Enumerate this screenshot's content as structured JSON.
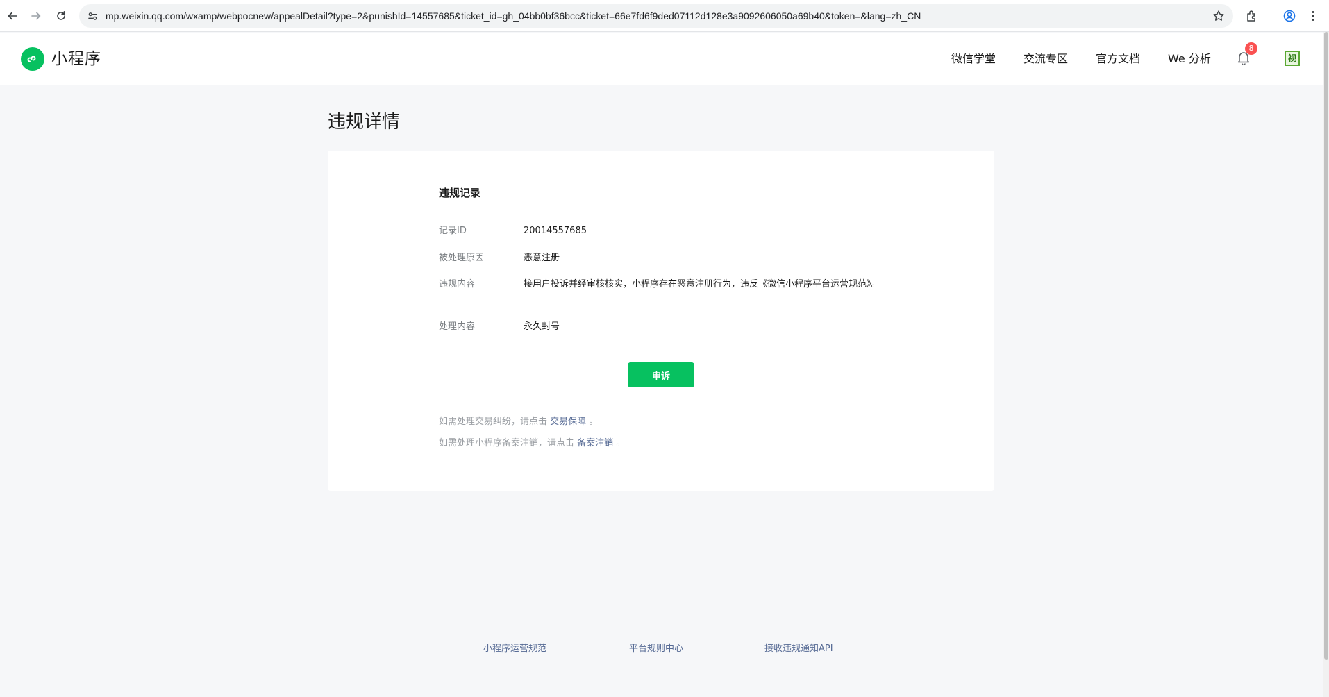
{
  "browser": {
    "url": "mp.weixin.qq.com/wxamp/webpocnew/appealDetail?type=2&punishId=14557685&ticket_id=gh_04bb0bf36bcc&ticket=66e7fd6f9ded07112d128e3a9092606050a69b40&token=&lang=zh_CN",
    "icons": [
      "back-icon",
      "forward-icon",
      "reload-icon",
      "site-info-icon",
      "star-icon",
      "extensions-icon",
      "profile-icon",
      "menu-icon"
    ]
  },
  "header": {
    "logo_text": "小程序",
    "nav": [
      "微信学堂",
      "交流专区",
      "官方文档",
      "We 分析"
    ],
    "notification_count": "8",
    "avatar_text": "视",
    "accent_color": "#07c160"
  },
  "page": {
    "title": "违规详情"
  },
  "record": {
    "section_title": "违规记录",
    "rows": [
      {
        "label": "记录ID",
        "value": "20014557685"
      },
      {
        "label": "被处理原因",
        "value": "恶意注册"
      },
      {
        "label": "违规内容",
        "value": "接用户投诉并经审核核实，小程序存在恶意注册行为，违反《微信小程序平台运营规范》。"
      },
      {
        "label": "处理内容",
        "value": "永久封号"
      }
    ],
    "appeal_button": "申诉"
  },
  "notes": [
    {
      "prefix": "如需处理交易纠纷，请点击",
      "link": "交易保障",
      "suffix": "。"
    },
    {
      "prefix": "如需处理小程序备案注销，请点击",
      "link": "备案注销",
      "suffix": "。"
    }
  ],
  "footer": {
    "links": [
      "小程序运营规范",
      "平台规则中心",
      "接收违规通知API"
    ]
  }
}
